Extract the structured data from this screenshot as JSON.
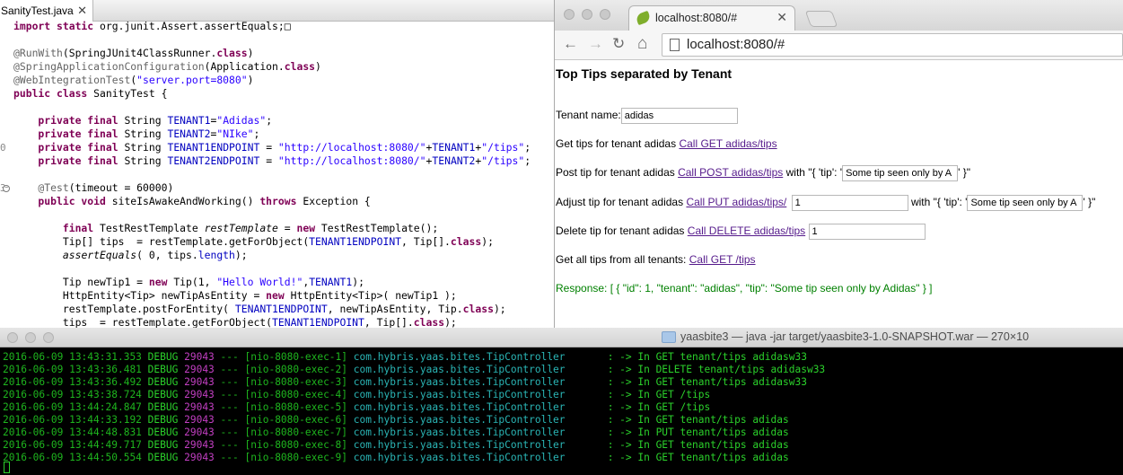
{
  "editor": {
    "tab_label": "SanityTest.java",
    "tab_close": "✕",
    "lines": [
      {
        "g": "",
        "segs": [
          {
            "t": "import static ",
            "c": "kw"
          },
          {
            "t": "org.junit.Assert.assertEquals;",
            "c": ""
          },
          {
            "t": "□",
            "c": ""
          }
        ]
      },
      {
        "g": "",
        "segs": []
      },
      {
        "g": "",
        "segs": [
          {
            "t": "@RunWith",
            "c": "ann"
          },
          {
            "t": "(SpringJUnit4ClassRunner.",
            "c": ""
          },
          {
            "t": "class",
            "c": "kw"
          },
          {
            "t": ")",
            "c": ""
          }
        ]
      },
      {
        "g": "",
        "segs": [
          {
            "t": "@SpringApplicationConfiguration",
            "c": "ann"
          },
          {
            "t": "(Application.",
            "c": ""
          },
          {
            "t": "class",
            "c": "kw"
          },
          {
            "t": ")",
            "c": ""
          }
        ]
      },
      {
        "g": "",
        "segs": [
          {
            "t": "@WebIntegrationTest",
            "c": "ann"
          },
          {
            "t": "(",
            "c": ""
          },
          {
            "t": "\"server.port=8080\"",
            "c": "str"
          },
          {
            "t": ")",
            "c": ""
          }
        ]
      },
      {
        "g": "",
        "segs": [
          {
            "t": "public class ",
            "c": "kw"
          },
          {
            "t": "SanityTest {",
            "c": ""
          }
        ]
      },
      {
        "g": "",
        "segs": []
      },
      {
        "g": "",
        "segs": [
          {
            "t": "    private final ",
            "c": "kw"
          },
          {
            "t": "String ",
            "c": ""
          },
          {
            "t": "TENANT1",
            "c": "fld"
          },
          {
            "t": "=",
            "c": ""
          },
          {
            "t": "\"Adidas\"",
            "c": "str"
          },
          {
            "t": ";",
            "c": ""
          }
        ]
      },
      {
        "g": "",
        "segs": [
          {
            "t": "    private final ",
            "c": "kw"
          },
          {
            "t": "String ",
            "c": ""
          },
          {
            "t": "TENANT2",
            "c": "fld"
          },
          {
            "t": "=",
            "c": ""
          },
          {
            "t": "\"NIke\"",
            "c": "str"
          },
          {
            "t": ";",
            "c": ""
          }
        ]
      },
      {
        "g": "0",
        "segs": [
          {
            "t": "    private final ",
            "c": "kw"
          },
          {
            "t": "String ",
            "c": ""
          },
          {
            "t": "TENANT1ENDPOINT",
            "c": "fld"
          },
          {
            "t": " = ",
            "c": ""
          },
          {
            "t": "\"http://localhost:8080/\"",
            "c": "str"
          },
          {
            "t": "+",
            "c": ""
          },
          {
            "t": "TENANT1",
            "c": "fld"
          },
          {
            "t": "+",
            "c": ""
          },
          {
            "t": "\"/tips\"",
            "c": "str"
          },
          {
            "t": ";",
            "c": ""
          }
        ]
      },
      {
        "g": "",
        "segs": [
          {
            "t": "    private final ",
            "c": "kw"
          },
          {
            "t": "String ",
            "c": ""
          },
          {
            "t": "TENANT2ENDPOINT",
            "c": "fld"
          },
          {
            "t": " = ",
            "c": ""
          },
          {
            "t": "\"http://localhost:8080/\"",
            "c": "str"
          },
          {
            "t": "+",
            "c": ""
          },
          {
            "t": "TENANT2",
            "c": "fld"
          },
          {
            "t": "+",
            "c": ""
          },
          {
            "t": "\"/tips\"",
            "c": "str"
          },
          {
            "t": ";",
            "c": ""
          }
        ]
      },
      {
        "g": "",
        "segs": []
      },
      {
        "g": "3",
        "fold": true,
        "segs": [
          {
            "t": "    @Test",
            "c": "ann"
          },
          {
            "t": "(timeout = 60000)",
            "c": ""
          }
        ]
      },
      {
        "g": "",
        "segs": [
          {
            "t": "    public void ",
            "c": "kw"
          },
          {
            "t": "siteIsAwakeAndWorking() ",
            "c": ""
          },
          {
            "t": "throws ",
            "c": "kw"
          },
          {
            "t": "Exception {",
            "c": ""
          }
        ]
      },
      {
        "g": "",
        "segs": []
      },
      {
        "g": "",
        "segs": [
          {
            "t": "        final ",
            "c": "kw"
          },
          {
            "t": "TestRestTemplate ",
            "c": ""
          },
          {
            "t": "restTemplate",
            "c": "it"
          },
          {
            "t": " = ",
            "c": ""
          },
          {
            "t": "new ",
            "c": "kw"
          },
          {
            "t": "TestRestTemplate();",
            "c": ""
          }
        ]
      },
      {
        "g": "",
        "segs": [
          {
            "t": "        Tip[] tips  = restTemplate.getForObject(",
            "c": ""
          },
          {
            "t": "TENANT1ENDPOINT",
            "c": "fld"
          },
          {
            "t": ", Tip[].",
            "c": ""
          },
          {
            "t": "class",
            "c": "kw"
          },
          {
            "t": ");",
            "c": ""
          }
        ]
      },
      {
        "g": "",
        "segs": [
          {
            "t": "        ",
            "c": ""
          },
          {
            "t": "assertEquals",
            "c": "it"
          },
          {
            "t": "( 0, tips.",
            "c": ""
          },
          {
            "t": "length",
            "c": "fld"
          },
          {
            "t": ");",
            "c": ""
          }
        ]
      },
      {
        "g": "",
        "segs": []
      },
      {
        "g": "",
        "segs": [
          {
            "t": "        Tip newTip1 = ",
            "c": ""
          },
          {
            "t": "new ",
            "c": "kw"
          },
          {
            "t": "Tip(1, ",
            "c": ""
          },
          {
            "t": "\"Hello World!\"",
            "c": "str"
          },
          {
            "t": ",",
            "c": ""
          },
          {
            "t": "TENANT1",
            "c": "fld"
          },
          {
            "t": ");",
            "c": ""
          }
        ]
      },
      {
        "g": "",
        "segs": [
          {
            "t": "        HttpEntity<Tip> newTipAsEntity = ",
            "c": ""
          },
          {
            "t": "new ",
            "c": "kw"
          },
          {
            "t": "HttpEntity<Tip>( newTip1 );",
            "c": ""
          }
        ]
      },
      {
        "g": "",
        "segs": [
          {
            "t": "        restTemplate.postForEntity( ",
            "c": ""
          },
          {
            "t": "TENANT1ENDPOINT",
            "c": "fld"
          },
          {
            "t": ", newTipAsEntity, Tip.",
            "c": ""
          },
          {
            "t": "class",
            "c": "kw"
          },
          {
            "t": ");",
            "c": ""
          }
        ]
      },
      {
        "g": "",
        "segs": [
          {
            "t": "        tips  = restTemplate.getForObject(",
            "c": ""
          },
          {
            "t": "TENANT1ENDPOINT",
            "c": "fld"
          },
          {
            "t": ", Tip[].",
            "c": ""
          },
          {
            "t": "class",
            "c": "kw"
          },
          {
            "t": ");",
            "c": ""
          }
        ]
      }
    ]
  },
  "browser": {
    "tab_title": "localhost:8080/#",
    "tab_close": "✕",
    "address": "localhost:8080/#",
    "nav": {
      "back": "←",
      "forward": "→",
      "reload": "↻",
      "home": "⌂"
    },
    "page": {
      "title": "Top Tips separated by Tenant",
      "tenant_label": "Tenant name:",
      "tenant_value": "adidas",
      "get_prefix": "Get tips for tenant adidas",
      "get_link": "Call GET adidas/tips",
      "post_prefix": "Post tip for tenant adidas",
      "post_link": "Call POST adidas/tips",
      "post_with": "with \"{ 'tip': '",
      "post_value": "Some tip seen only by A",
      "post_suffix": "' }\"",
      "put_prefix": "Adjust tip for tenant adidas",
      "put_link": "Call PUT adidas/tips/",
      "put_id": "1",
      "put_with": "with \"{ 'tip': '",
      "put_value": "Some tip seen only by A",
      "put_suffix": "' }\"",
      "delete_prefix": "Delete tip for tenant adidas",
      "delete_link": "Call DELETE adidas/tips",
      "delete_id": "1",
      "all_prefix": "Get all tips from all tenants:",
      "all_link": "Call GET /tips",
      "response": "Response: [ { \"id\": 1, \"tenant\": \"adidas\", \"tip\": \"Some tip seen only by Adidas\" } ]"
    }
  },
  "terminal": {
    "title": "yaasbite3 — java -jar target/yaasbite3-1.0-SNAPSHOT.war — 270×10",
    "logs": [
      {
        "ts": "2016-06-09 13:43:31.353",
        "lvl": "DEBUG",
        "pid": "29043",
        "sep": "---",
        "thr": "[nio-8080-exec-1]",
        "cls": "com.hybris.yaas.bites.TipController",
        "msg": ": -> In GET tenant/tips adidasw33"
      },
      {
        "ts": "2016-06-09 13:43:36.481",
        "lvl": "DEBUG",
        "pid": "29043",
        "sep": "---",
        "thr": "[nio-8080-exec-2]",
        "cls": "com.hybris.yaas.bites.TipController",
        "msg": ": -> In DELETE tenant/tips adidasw33"
      },
      {
        "ts": "2016-06-09 13:43:36.492",
        "lvl": "DEBUG",
        "pid": "29043",
        "sep": "---",
        "thr": "[nio-8080-exec-3]",
        "cls": "com.hybris.yaas.bites.TipController",
        "msg": ": -> In GET tenant/tips adidasw33"
      },
      {
        "ts": "2016-06-09 13:43:38.724",
        "lvl": "DEBUG",
        "pid": "29043",
        "sep": "---",
        "thr": "[nio-8080-exec-4]",
        "cls": "com.hybris.yaas.bites.TipController",
        "msg": ": -> In GET /tips"
      },
      {
        "ts": "2016-06-09 13:44:24.847",
        "lvl": "DEBUG",
        "pid": "29043",
        "sep": "---",
        "thr": "[nio-8080-exec-5]",
        "cls": "com.hybris.yaas.bites.TipController",
        "msg": ": -> In GET /tips"
      },
      {
        "ts": "2016-06-09 13:44:33.192",
        "lvl": "DEBUG",
        "pid": "29043",
        "sep": "---",
        "thr": "[nio-8080-exec-6]",
        "cls": "com.hybris.yaas.bites.TipController",
        "msg": ": -> In GET tenant/tips adidas"
      },
      {
        "ts": "2016-06-09 13:44:48.831",
        "lvl": "DEBUG",
        "pid": "29043",
        "sep": "---",
        "thr": "[nio-8080-exec-7]",
        "cls": "com.hybris.yaas.bites.TipController",
        "msg": ": -> In PUT tenant/tips adidas"
      },
      {
        "ts": "2016-06-09 13:44:49.717",
        "lvl": "DEBUG",
        "pid": "29043",
        "sep": "---",
        "thr": "[nio-8080-exec-8]",
        "cls": "com.hybris.yaas.bites.TipController",
        "msg": ": -> In GET tenant/tips adidas"
      },
      {
        "ts": "2016-06-09 13:44:50.554",
        "lvl": "DEBUG",
        "pid": "29043",
        "sep": "---",
        "thr": "[nio-8080-exec-9]",
        "cls": "com.hybris.yaas.bites.TipController",
        "msg": ": -> In GET tenant/tips adidas"
      }
    ]
  }
}
